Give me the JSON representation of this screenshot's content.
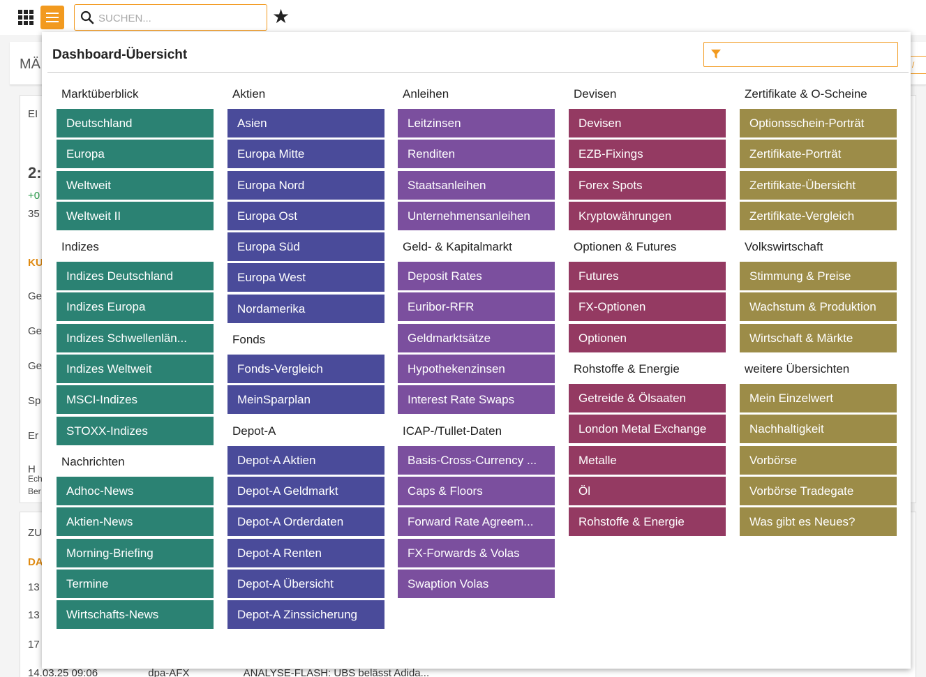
{
  "topbar": {
    "search_placeholder": "SUCHEN..."
  },
  "background": {
    "page_title": "MÄ",
    "snippets": [
      "EI",
      "2:",
      "+0",
      "35",
      "KU",
      "Ge",
      "Ge",
      "Ge",
      "Sp",
      "Er",
      "H",
      "Ech",
      "Ber",
      "ZU",
      "DA",
      "13",
      "13",
      "17"
    ],
    "footer": {
      "time": "14.03.25 09:06",
      "source": "dpa-AFX",
      "headline": "ANALYSE-FLASH: UBS belässt Adida..."
    }
  },
  "overlay": {
    "title": "Dashboard-Übersicht",
    "filter_value": ""
  },
  "colors": {
    "accent": "#f29a1f",
    "teal": "#2b8273",
    "indigo": "#4a4b9a",
    "violet": "#7b4f9e",
    "crimson": "#943a62",
    "olive": "#9c8c48"
  },
  "columns": [
    {
      "color": "#2b8273",
      "groups": [
        {
          "heading": "Marktüberblick",
          "items": [
            "Deutschland",
            "Europa",
            "Weltweit",
            "Weltweit II"
          ]
        },
        {
          "heading": "Indizes",
          "items": [
            "Indizes Deutschland",
            "Indizes Europa",
            "Indizes Schwellenlän...",
            "Indizes Weltweit",
            "MSCI-Indizes",
            "STOXX-Indizes"
          ]
        },
        {
          "heading": "Nachrichten",
          "items": [
            "Adhoc-News",
            "Aktien-News",
            "Morning-Briefing",
            "Termine",
            "Wirtschafts-News"
          ]
        }
      ]
    },
    {
      "color": "#4a4b9a",
      "groups": [
        {
          "heading": "Aktien",
          "items": [
            "Asien",
            "Europa Mitte",
            "Europa Nord",
            "Europa Ost",
            "Europa Süd",
            "Europa West",
            "Nordamerika"
          ]
        },
        {
          "heading": "Fonds",
          "items": [
            "Fonds-Vergleich",
            "MeinSparplan"
          ]
        },
        {
          "heading": "Depot-A",
          "items": [
            "Depot-A Aktien",
            "Depot-A Geldmarkt",
            "Depot-A Orderdaten",
            "Depot-A Renten",
            "Depot-A Übersicht",
            "Depot-A Zinssicherung"
          ]
        }
      ]
    },
    {
      "color": "#7b4f9e",
      "groups": [
        {
          "heading": "Anleihen",
          "items": [
            "Leitzinsen",
            "Renditen",
            "Staatsanleihen",
            "Unternehmensanleihen"
          ]
        },
        {
          "heading": "Geld- & Kapitalmarkt",
          "items": [
            "Deposit Rates",
            "Euribor-RFR",
            "Geldmarktsätze",
            "Hypothekenzinsen",
            "Interest Rate Swaps"
          ]
        },
        {
          "heading": "ICAP-/Tullet-Daten",
          "items": [
            "Basis-Cross-Currency ...",
            "Caps & Floors",
            "Forward Rate Agreem...",
            "FX-Forwards & Volas",
            "Swaption Volas"
          ]
        }
      ]
    },
    {
      "color": "#943a62",
      "groups": [
        {
          "heading": "Devisen",
          "items": [
            "Devisen",
            "EZB-Fixings",
            "Forex Spots",
            "Kryptowährungen"
          ]
        },
        {
          "heading": "Optionen & Futures",
          "items": [
            "Futures",
            "FX-Optionen",
            "Optionen"
          ]
        },
        {
          "heading": "Rohstoffe & Energie",
          "items": [
            "Getreide & Ölsaaten",
            "London Metal Exchange",
            "Metalle",
            "Öl",
            "Rohstoffe & Energie"
          ]
        }
      ]
    },
    {
      "color": "#9c8c48",
      "groups": [
        {
          "heading": "Zertifikate & O-Scheine",
          "items": [
            "Optionsschein-Porträt",
            "Zertifikate-Porträt",
            "Zertifikate-Übersicht",
            "Zertifikate-Vergleich"
          ]
        },
        {
          "heading": "Volkswirtschaft",
          "items": [
            "Stimmung & Preise",
            "Wachstum & Produktion",
            "Wirtschaft & Märkte"
          ]
        },
        {
          "heading": "weitere Übersichten",
          "items": [
            "Mein Einzelwert",
            "Nachhaltigkeit",
            "Vorbörse",
            "Vorbörse Tradegate",
            "Was gibt es Neues?"
          ]
        }
      ]
    }
  ]
}
